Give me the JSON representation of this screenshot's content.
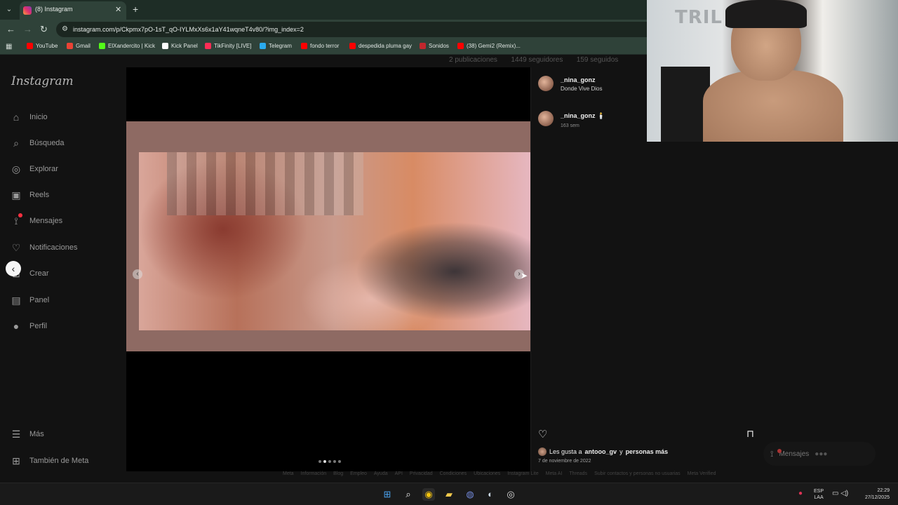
{
  "browser": {
    "tab_title": "(8) Instagram",
    "url": "instagram.com/p/Ckpmx7pO-1sT_qO-IYLMxXs6x1aY41wqneT4v80/?img_index=2",
    "new_tab_symbol": "+",
    "bookmarks": [
      {
        "label": "YouTube",
        "color": "#ff0000"
      },
      {
        "label": "Gmail",
        "color": "#ea4335"
      },
      {
        "label": "ElXandercito | Kick",
        "color": "#53fc18"
      },
      {
        "label": "Kick Panel",
        "color": "#ffffff"
      },
      {
        "label": "TikFinity [LIVE]",
        "color": "#ff2d55"
      },
      {
        "label": "Telegram",
        "color": "#2aabee"
      },
      {
        "label": "fondo terror",
        "color": "#ff0000"
      },
      {
        "label": "despedida pluma gay",
        "color": "#ff0000"
      },
      {
        "label": "Sonidos",
        "color": "#c1272d"
      },
      {
        "label": "(38) Gemi2 (Remix)...",
        "color": "#ff0000"
      }
    ]
  },
  "instagram": {
    "logo": "Instagram",
    "nav": [
      {
        "label": "Inicio",
        "icon": "home-icon"
      },
      {
        "label": "Búsqueda",
        "icon": "search-icon"
      },
      {
        "label": "Explorar",
        "icon": "compass-icon"
      },
      {
        "label": "Reels",
        "icon": "reels-icon"
      },
      {
        "label": "Mensajes",
        "icon": "messenger-icon"
      },
      {
        "label": "Notificaciones",
        "icon": "heart-icon"
      },
      {
        "label": "Crear",
        "icon": "plus-square-icon"
      },
      {
        "label": "Panel",
        "icon": "chart-icon"
      },
      {
        "label": "Perfil",
        "icon": "avatar-icon"
      }
    ],
    "more_label": "Más",
    "meta_label": "También de Meta",
    "profile_backdrop": {
      "posts": "2 publicaciones",
      "followers": "1449 seguidores",
      "following": "159 seguidos"
    },
    "post": {
      "author": "_nina_gonz",
      "location": "Donde Vive Dios",
      "caption_user": "_nina_gonz",
      "caption_emoji": "🕯️",
      "caption_age": "163 sem",
      "likes_prefix": "Les gusta a",
      "likes_user": "antooo_gv",
      "likes_suffix": "y",
      "likes_others": "personas más",
      "date": "7 de noviembre de 2022",
      "carousel_count": 5,
      "carousel_index": 2
    },
    "footer_links": [
      "Meta",
      "Información",
      "Blog",
      "Empleo",
      "Ayuda",
      "API",
      "Privacidad",
      "Condiciones",
      "Ubicaciones",
      "Instagram Lite",
      "Meta AI",
      "Threads",
      "Subir contactos y personas no usuarias",
      "Meta Verified"
    ],
    "messages_pill": "Mensajes"
  },
  "webcam": {
    "logo_text": "TRIL"
  },
  "taskbar": {
    "lang_top": "ESP",
    "lang_bottom": "LAA",
    "time": "22:29",
    "date": "27/12/2025"
  }
}
